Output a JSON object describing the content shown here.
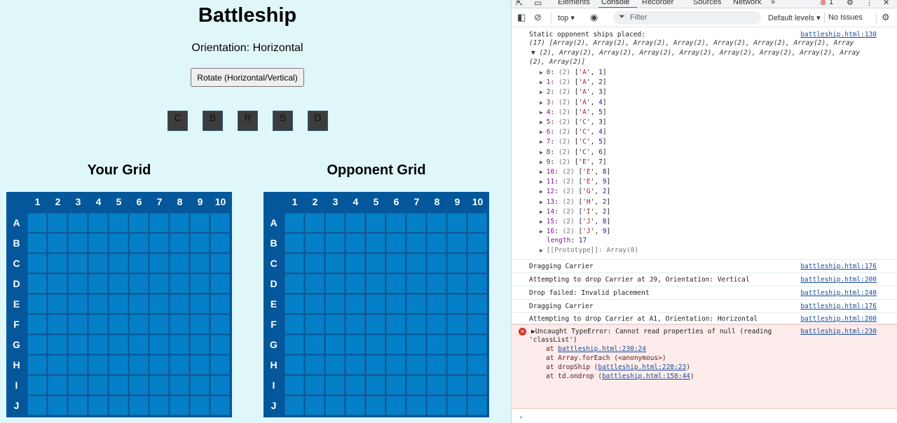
{
  "game": {
    "title": "Battleship",
    "orientation_text": "Orientation: Horizontal",
    "rotate_label": "Rotate (Horizontal/Vertical)",
    "ships": [
      "C",
      "B",
      "R",
      "S",
      "D"
    ],
    "your_grid_title": "Your Grid",
    "opponent_grid_title": "Opponent Grid",
    "columns": [
      "1",
      "2",
      "3",
      "4",
      "5",
      "6",
      "7",
      "8",
      "9",
      "10"
    ],
    "rows": [
      "A",
      "B",
      "C",
      "D",
      "E",
      "F",
      "G",
      "H",
      "I",
      "J"
    ],
    "cell_mark": "."
  },
  "devtools": {
    "tabs": [
      "Elements",
      "Console",
      "Recorder",
      "Sources",
      "Network"
    ],
    "active_tab": "Console",
    "more_tabs": "»",
    "error_count": "1",
    "context": "top ▾",
    "filter_placeholder": "Filter",
    "levels": "Default levels ▾",
    "issues": "No Issues",
    "messages": {
      "m1_text": "Static opponent ships placed:",
      "m1_src": "battleship.html:130",
      "m1_arr_1": "(17) [Array(2), Array(2), Array(2), Array(2), Array(2), Array(2), Array(2), Array",
      "m1_arr_2": "▼ (2), Array(2), Array(2), Array(2), Array(2), Array(2), Array(2), Array(2), Array",
      "m1_arr_3": "(2), Array(2)]",
      "items": [
        {
          "i": "0",
          "r": "A",
          "c": "1"
        },
        {
          "i": "1",
          "r": "A",
          "c": "2"
        },
        {
          "i": "2",
          "r": "A",
          "c": "3"
        },
        {
          "i": "3",
          "r": "A",
          "c": "4"
        },
        {
          "i": "4",
          "r": "A",
          "c": "5"
        },
        {
          "i": "5",
          "r": "C",
          "c": "3"
        },
        {
          "i": "6",
          "r": "C",
          "c": "4"
        },
        {
          "i": "7",
          "r": "C",
          "c": "5"
        },
        {
          "i": "8",
          "r": "C",
          "c": "6"
        },
        {
          "i": "9",
          "r": "E",
          "c": "7"
        },
        {
          "i": "10",
          "r": "E",
          "c": "8"
        },
        {
          "i": "11",
          "r": "E",
          "c": "9"
        },
        {
          "i": "12",
          "r": "G",
          "c": "2"
        },
        {
          "i": "13",
          "r": "H",
          "c": "2"
        },
        {
          "i": "14",
          "r": "I",
          "c": "2"
        },
        {
          "i": "15",
          "r": "J",
          "c": "8"
        },
        {
          "i": "16",
          "r": "J",
          "c": "9"
        }
      ],
      "length_label": "length",
      "length_value": "17",
      "prototype": "[[Prototype]]: Array(0)",
      "m2_text": "Dragging Carrier",
      "m2_src": "battleship.html:176",
      "m3_text": "Attempting to drop Carrier at J9, Orientation: Vertical",
      "m3_src": "battleship.html:200",
      "m4_text": "Drop failed: Invalid placement",
      "m4_src": "battleship.html:240",
      "m5_text": "Dragging Carrier",
      "m5_src": "battleship.html:176",
      "m6_text": "Attempting to drop Carrier at A1, Orientation: Horizontal",
      "m6_src": "battleship.html:200",
      "err_line1": "▶Uncaught TypeError: Cannot read properties of null (reading",
      "err_line2": "'classList')",
      "err_src": "battleship.html:230",
      "stack_1_pre": "at ",
      "stack_1_link": "battleship.html:230:24",
      "stack_2": "at Array.forEach (<anonymous>)",
      "stack_3_pre": "at dropShip (",
      "stack_3_link": "battleship.html:228:23",
      "stack_3_post": ")",
      "stack_4_pre": "at td.ondrop (",
      "stack_4_link": "battleship.html:158:44",
      "stack_4_post": ")"
    },
    "prompt": "›"
  }
}
